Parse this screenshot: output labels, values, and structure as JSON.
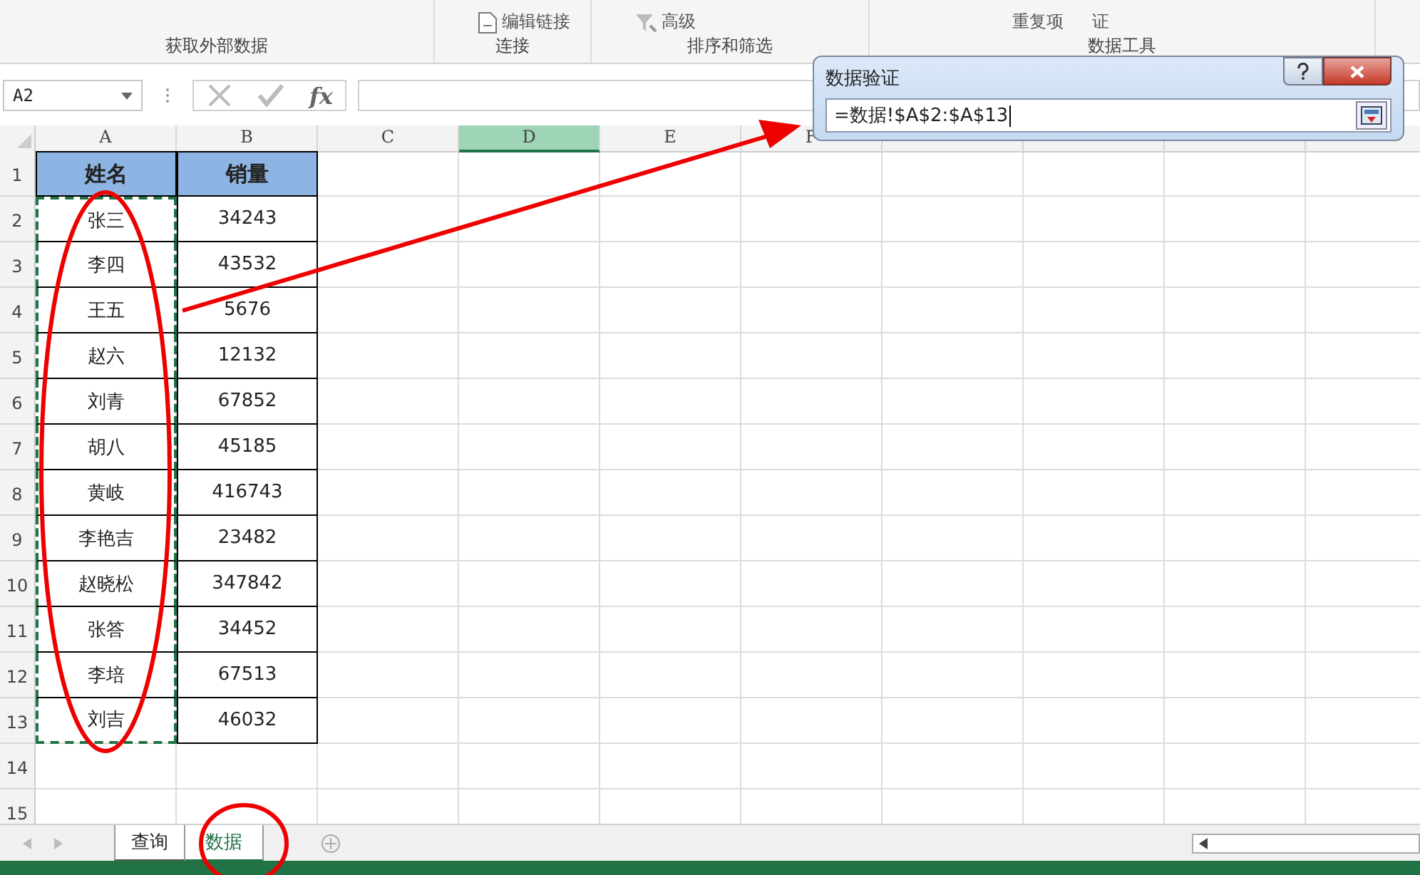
{
  "ribbon": {
    "groups": [
      {
        "label": "获取外部数据"
      },
      {
        "label": "连接",
        "buttons": [
          {
            "label": "编辑链接",
            "kind": "link"
          }
        ]
      },
      {
        "label": "排序和筛选",
        "buttons": [
          {
            "label": "高级",
            "kind": "filter"
          }
        ]
      },
      {
        "label": "数据工具",
        "buttons": [
          {
            "label": "重复项",
            "kind": "text"
          },
          {
            "label": "证",
            "kind": "text"
          }
        ]
      }
    ]
  },
  "name_box": {
    "value": "A2"
  },
  "formula_bar": {
    "function_label": "fx"
  },
  "columns": [
    {
      "label": "A",
      "selected": false
    },
    {
      "label": "B",
      "selected": false
    },
    {
      "label": "C",
      "selected": false
    },
    {
      "label": "D",
      "selected": true
    },
    {
      "label": "E",
      "selected": false
    },
    {
      "label": "F",
      "selected": false
    }
  ],
  "row_numbers": [
    "1",
    "2",
    "3",
    "4",
    "5",
    "6",
    "7",
    "8",
    "9",
    "10",
    "11",
    "12",
    "13",
    "14",
    "15"
  ],
  "table": {
    "header": [
      "姓名",
      "销量"
    ],
    "copy_marquee": true,
    "rows": [
      {
        "name": "张三",
        "sales": "34243"
      },
      {
        "name": "李四",
        "sales": "43532"
      },
      {
        "name": "王五",
        "sales": "5676"
      },
      {
        "name": "赵六",
        "sales": "12132"
      },
      {
        "name": "刘青",
        "sales": "67852"
      },
      {
        "name": "胡八",
        "sales": "45185"
      },
      {
        "name": "黄岐",
        "sales": "416743"
      },
      {
        "name": "李艳吉",
        "sales": "23482"
      },
      {
        "name": "赵晓松",
        "sales": "347842"
      },
      {
        "name": "张答",
        "sales": "34452"
      },
      {
        "name": "李培",
        "sales": "67513"
      },
      {
        "name": "刘吉",
        "sales": "46032"
      }
    ]
  },
  "dialog": {
    "title": "数据验证",
    "value": "=数据!$A$2:$A$13"
  },
  "sheet_tabs": [
    {
      "label": "查询",
      "selected": false
    },
    {
      "label": "数据",
      "selected": true
    }
  ],
  "annotations": [
    {
      "kind": "ellipse"
    },
    {
      "kind": "arrow"
    },
    {
      "kind": "circle"
    }
  ]
}
